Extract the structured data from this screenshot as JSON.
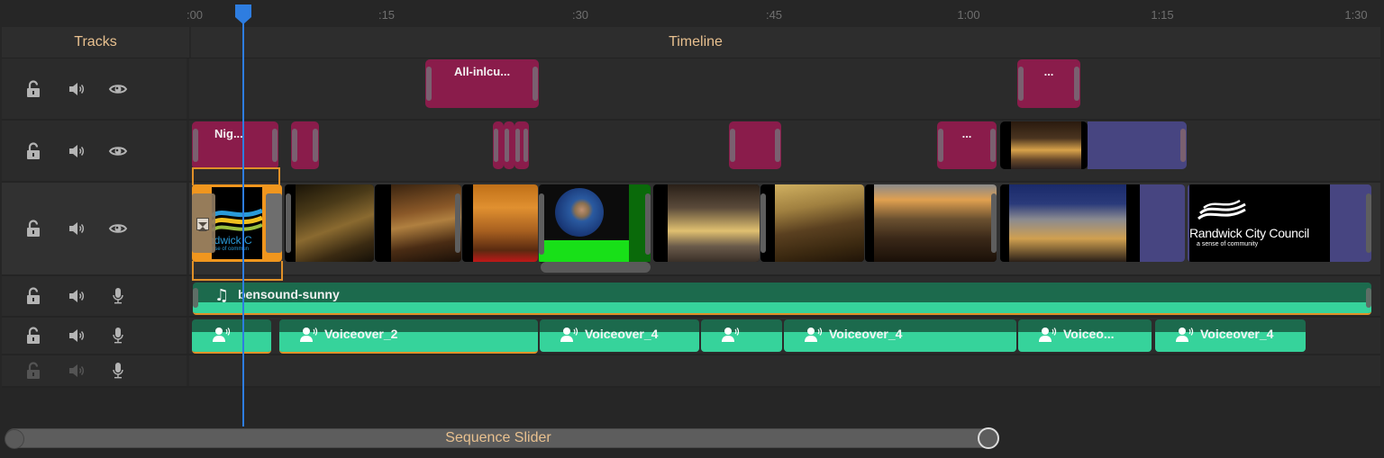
{
  "ruler": {
    "ticks": [
      ":00",
      ":15",
      ":30",
      ":45",
      "1:00",
      "1:15",
      "1:30"
    ],
    "playhead_time": "0:04"
  },
  "header": {
    "tracks_label": "Tracks",
    "timeline_label": "Timeline"
  },
  "tracks": [
    {
      "type": "title",
      "locked": false,
      "muted": false,
      "visible": true,
      "third_icon": "eye-icon"
    },
    {
      "type": "title",
      "locked": false,
      "muted": false,
      "visible": true,
      "third_icon": "eye-icon"
    },
    {
      "type": "video",
      "locked": false,
      "muted": false,
      "visible": true,
      "third_icon": "eye-icon"
    },
    {
      "type": "audio",
      "locked": false,
      "muted": false,
      "third_icon": "microphone-icon"
    },
    {
      "type": "audio",
      "locked": false,
      "muted": false,
      "third_icon": "microphone-icon"
    },
    {
      "type": "audio",
      "locked": false,
      "muted": false,
      "disabled": true,
      "third_icon": "microphone-icon"
    }
  ],
  "title_track_1": {
    "clips": [
      {
        "label": "All-inlcu..."
      },
      {
        "label": "..."
      }
    ]
  },
  "title_track_2": {
    "clips": [
      {
        "label": "Nig..."
      },
      {
        "label": ""
      },
      {
        "label": ""
      },
      {
        "label": ""
      },
      {
        "label": ""
      },
      {
        "label": ""
      },
      {
        "label": "..."
      }
    ]
  },
  "video_track": {
    "clips": [
      {
        "name": "randwick-logo-color",
        "text": "ndwick C",
        "subtext": "nse of commun"
      },
      {
        "name": "street-night"
      },
      {
        "name": "bar-interior"
      },
      {
        "name": "theatre-interior"
      },
      {
        "name": "earth-screen-recording"
      },
      {
        "name": "theatre-facade-night"
      },
      {
        "name": "bar-patrons"
      },
      {
        "name": "sunset-balcony"
      },
      {
        "name": "theatre-dusk"
      },
      {
        "name": "randwick-logo-bw",
        "text": "Randwick City Council",
        "subtext": "a sense of community"
      }
    ]
  },
  "music_track": {
    "label": "bensound-sunny"
  },
  "voiceover_track": {
    "clips": [
      {
        "label": ""
      },
      {
        "label": "Voiceover_2"
      },
      {
        "label": "Voiceover_4"
      },
      {
        "label": ""
      },
      {
        "label": "Voiceover_4"
      },
      {
        "label": "Voiceo..."
      },
      {
        "label": "Voiceover_4"
      }
    ]
  },
  "slider": {
    "label": "Sequence Slider",
    "range_start": 0.0,
    "range_end": 1.0
  },
  "colors": {
    "title_clip": "#8a1c4b",
    "transition_clip": "#474581",
    "audio_clip": "#1c6a4d",
    "audio_wave": "#36d39b",
    "selection": "#e09028",
    "playhead": "#2e7de0",
    "label_accent": "#e8c08f"
  }
}
